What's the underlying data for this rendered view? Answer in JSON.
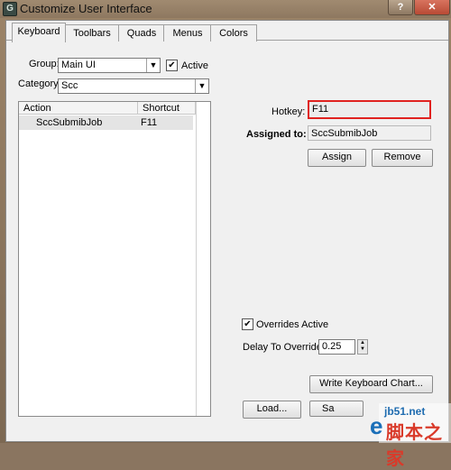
{
  "window": {
    "title": "Customize User Interface",
    "help_label": "?",
    "close_label": "✕"
  },
  "tabs": [
    "Keyboard",
    "Toolbars",
    "Quads",
    "Menus",
    "Colors"
  ],
  "keyboard": {
    "group_label": "Group:",
    "group_value": "Main UI",
    "active_label": "Active",
    "active_checked": true,
    "category_label": "Category:",
    "category_value": "Scc",
    "list": {
      "columns": [
        "Action",
        "Shortcut"
      ],
      "rows": [
        {
          "action": "SccSubmibJob",
          "shortcut": "F11"
        }
      ]
    },
    "hotkey_label": "Hotkey:",
    "hotkey_value": "F11",
    "assigned_label": "Assigned to:",
    "assigned_value": "SccSubmibJob",
    "assign_label": "Assign",
    "remove_label": "Remove",
    "overrides_label": "Overrides Active",
    "overrides_checked": true,
    "delay_label": "Delay To Override:",
    "delay_value": "0.25",
    "write_chart_label": "Write Keyboard Chart...",
    "load_label": "Load...",
    "save_label": "Sa"
  },
  "watermark": {
    "url": "jb51.net",
    "text": "脚本之家"
  }
}
